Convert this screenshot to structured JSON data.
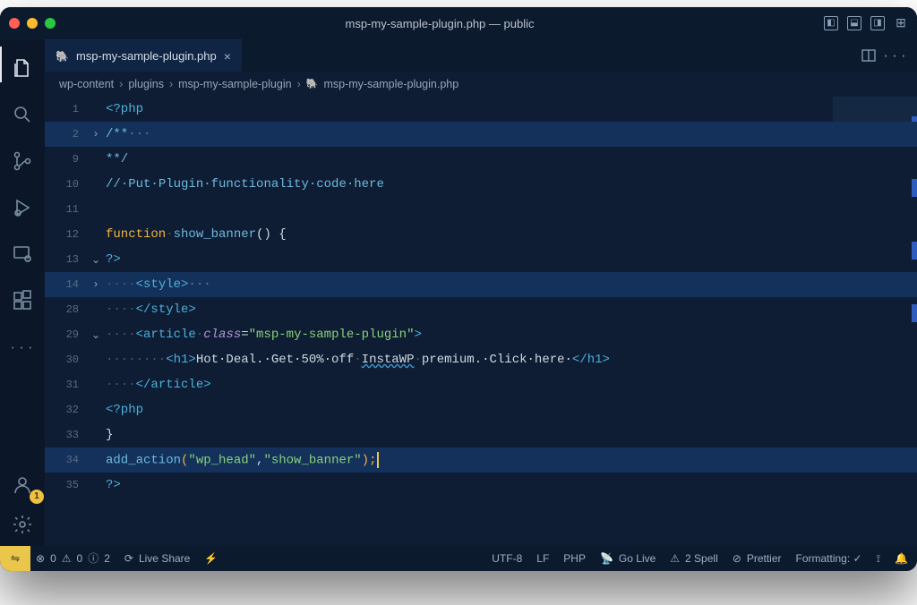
{
  "window": {
    "title": "msp-my-sample-plugin.php — public",
    "traffic_colors": {
      "close": "#ff5f57",
      "min": "#febc2e",
      "max": "#28c840"
    }
  },
  "activity_bar": {
    "badge_count": "1"
  },
  "tabs": {
    "active": {
      "label": "msp-my-sample-plugin.php",
      "close_glyph": "×"
    }
  },
  "editor_actions": {
    "ellipsis": "···"
  },
  "breadcrumbs": {
    "parts": [
      "wp-content",
      "plugins",
      "msp-my-sample-plugin",
      "msp-my-sample-plugin.php"
    ],
    "sep": "›"
  },
  "code": {
    "line_numbers": [
      "1",
      "2",
      "9",
      "10",
      "11",
      "12",
      "13",
      "14",
      "28",
      "29",
      "30",
      "31",
      "32",
      "33",
      "34",
      "35"
    ],
    "fold": {
      "right": "›",
      "down": "⌄"
    },
    "lines": {
      "l1": "<?php",
      "l2_com": "/**",
      "l2_trail": "···",
      "l9": "**/",
      "l10_a": "//",
      "l10_b": "·Put·Plugin·functionality·code·here",
      "l12_kw": "function",
      "l12_sp": "·",
      "l12_name": "show_banner",
      "l12_rest": "() {",
      "l13": "?>",
      "l14_dots": "····",
      "l14_tag": "<style>",
      "l14_trail": "···",
      "l28_dots": "····",
      "l28_tag": "</style>",
      "l29_dots": "····",
      "l29_open": "<article",
      "l29_sp": "·",
      "l29_attr": "class",
      "l29_eq": "=",
      "l29_str": "\"msp-my-sample-plugin\"",
      "l29_close": ">",
      "l30_dots": "········",
      "l30_h1o": "<h1>",
      "l30_txt1": "Hot·Deal.·Get·50%·off",
      "l30_sp1": "·",
      "l30_wave": "InstaWP",
      "l30_sp2": "·",
      "l30_txt2": "premium.·Click·here·",
      "l30_h1c": "</h1>",
      "l31_dots": "····",
      "l31_tag": "</article>",
      "l32": "<?php",
      "l33": "}",
      "l34_fn": "add_action",
      "l34_p1": "(",
      "l34_s1": "\"wp_head\"",
      "l34_c": ",",
      "l34_s2": "\"show_banner\"",
      "l34_p2": ");",
      "l35": "?>"
    }
  },
  "status_bar": {
    "remote_glyph": "⇋",
    "errors_glyph": "⊗",
    "errors": "0",
    "warnings_glyph": "⚠",
    "warnings": "0",
    "info_glyph": "ⓘ",
    "info": "2",
    "live_share_glyph": "⟳",
    "live_share": " Live Share",
    "bolt": "⚡",
    "encoding": "UTF-8",
    "eol": "LF",
    "lang": "PHP",
    "go_live_glyph": "📡",
    "go_live": " Go Live",
    "spell_glyph": "⚠",
    "spell": " 2 Spell",
    "prettier_glyph": "⊘",
    "prettier": " Prettier",
    "formatting": "Formatting: ✓",
    "port_glyph": "⟟",
    "bell": "🔔"
  }
}
